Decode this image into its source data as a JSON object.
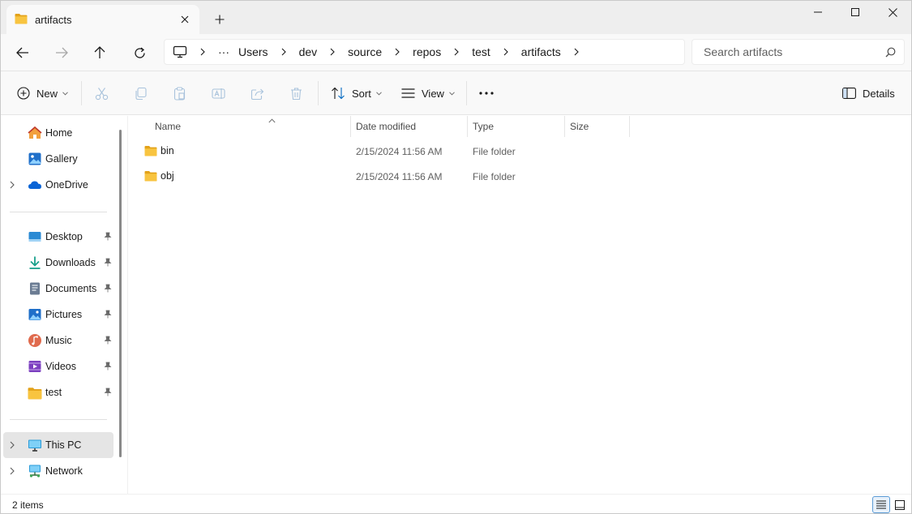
{
  "window": {
    "tab_title": "artifacts",
    "new_tab_glyph": "+"
  },
  "address": {
    "root_icon": "this-pc-icon",
    "overflow": "···",
    "crumbs": [
      "Users",
      "dev",
      "source",
      "repos",
      "test",
      "artifacts"
    ]
  },
  "search": {
    "placeholder": "Search artifacts"
  },
  "commands": {
    "new_label": "New",
    "sort_label": "Sort",
    "view_label": "View",
    "more_glyph": "···",
    "details_label": "Details"
  },
  "nav": {
    "top": [
      {
        "label": "Home",
        "icon": "home-icon"
      },
      {
        "label": "Gallery",
        "icon": "gallery-icon"
      },
      {
        "label": "OneDrive",
        "icon": "onedrive-icon"
      }
    ],
    "quick_access": [
      {
        "label": "Desktop",
        "icon": "desktop-icon"
      },
      {
        "label": "Downloads",
        "icon": "downloads-icon"
      },
      {
        "label": "Documents",
        "icon": "documents-icon"
      },
      {
        "label": "Pictures",
        "icon": "pictures-icon"
      },
      {
        "label": "Music",
        "icon": "music-icon"
      },
      {
        "label": "Videos",
        "icon": "videos-icon"
      },
      {
        "label": "test",
        "icon": "folder-icon"
      }
    ],
    "bottom": [
      {
        "label": "This PC",
        "icon": "this-pc-icon",
        "selected": true
      },
      {
        "label": "Network",
        "icon": "network-icon",
        "selected": false
      }
    ]
  },
  "columns": {
    "name": "Name",
    "date": "Date modified",
    "type": "Type",
    "size": "Size"
  },
  "files": [
    {
      "name": "bin",
      "date": "2/15/2024 11:56 AM",
      "type": "File folder",
      "size": ""
    },
    {
      "name": "obj",
      "date": "2/15/2024 11:56 AM",
      "type": "File folder",
      "size": ""
    }
  ],
  "status": {
    "item_count": "2 items"
  },
  "colors": {
    "accent": "#0067c0",
    "folder": "#f8c440",
    "folder_dark": "#e3a21a"
  }
}
